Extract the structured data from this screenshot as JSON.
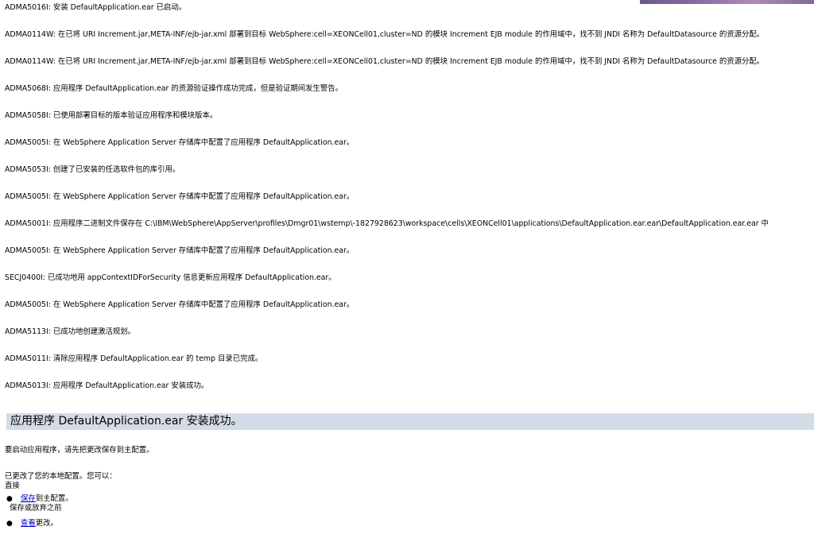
{
  "log": [
    "ADMA5016I: 安装  DefaultApplication.ear 已启动。",
    "ADMA0114W: 在已将  URI Increment.jar,META-INF/ejb-jar.xml 部署到目标  WebSphere:cell=XEONCell01,cluster=ND 的模块  Increment EJB module 的作用域中，找不到  JNDI 名称为  DefaultDatasource 的资源分配。",
    "ADMA0114W: 在已将  URI Increment.jar,META-INF/ejb-jar.xml 部署到目标  WebSphere:cell=XEONCell01,cluster=ND 的模块  Increment EJB module 的作用域中，找不到  JNDI 名称为  DefaultDatasource 的资源分配。",
    "ADMA5068I: 应用程序  DefaultApplication.ear 的资源验证操作成功完成，但是验证期间发生警告。",
    "ADMA5058I: 已使用部署目标的版本验证应用程序和模块版本。",
    "ADMA5005I: 在  WebSphere Application Server 存储库中配置了应用程序  DefaultApplication.ear。",
    "ADMA5053I: 创建了已安装的任选软件包的库引用。",
    "ADMA5005I: 在  WebSphere Application Server 存储库中配置了应用程序  DefaultApplication.ear。",
    "ADMA5001I: 应用程序二进制文件保存在  C:\\IBM\\WebSphere\\AppServer\\profiles\\Dmgr01\\wstemp\\-1827928623\\workspace\\cells\\XEONCell01\\applications\\DefaultApplication.ear.ear\\DefaultApplication.ear.ear 中",
    "ADMA5005I: 在  WebSphere Application Server 存储库中配置了应用程序  DefaultApplication.ear。",
    "SECJ0400I: 已成功地用  appContextIDForSecurity 信息更新应用程序  DefaultApplication.ear。",
    "ADMA5005I: 在  WebSphere Application Server 存储库中配置了应用程序  DefaultApplication.ear。",
    "ADMA5113I: 已成功地创建激活规划。",
    "ADMA5011I: 清除应用程序  DefaultApplication.ear 的  temp 目录已完成。",
    "ADMA5013I: 应用程序  DefaultApplication.ear 安装成功。"
  ],
  "banner": {
    "text": "应用程序  DefaultApplication.ear 安装成功。"
  },
  "notices": {
    "restart": "要启动应用程序，请先把更改保存到主配置。",
    "changed": "已更改了您的本地配置。您可以：",
    "direct": "直接"
  },
  "options": {
    "bullet": "●",
    "save_link": "保存",
    "save_suffix": "到主配置。",
    "before_label": "保存或放弃之前",
    "review_link": "查看",
    "review_suffix": "更改。"
  }
}
